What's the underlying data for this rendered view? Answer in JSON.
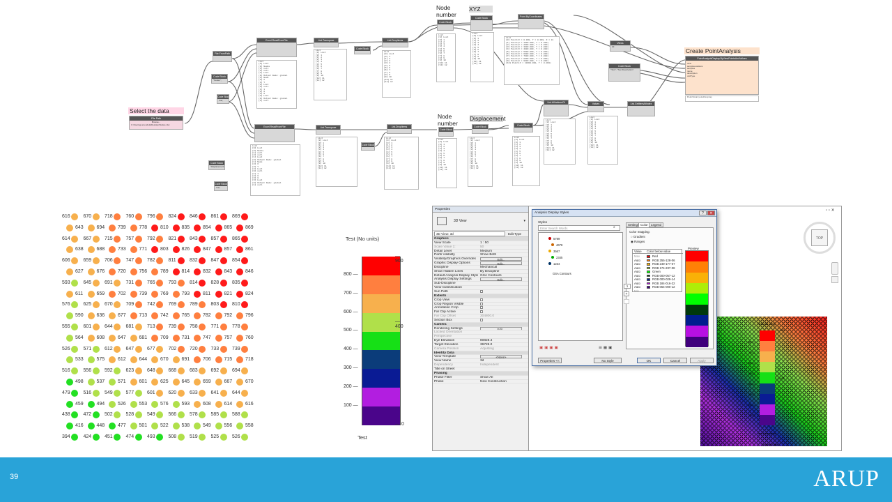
{
  "graph": {
    "labels": {
      "select": "Select the data",
      "node_number_top": "Node number",
      "xyz": "XYZ",
      "node_number_bottom": "Node number",
      "displacement": "Displacement",
      "create": "Create PointAnalysis"
    },
    "nodes": {
      "file_path": "File Path",
      "file_path_btn": "Browse...",
      "file_path_value": "C:\\Users\\g.amendola\\Desktop\\Nodes.xlsx",
      "file_from_path": "File.FromPath",
      "code_block_1": "Code Block",
      "code_block_1_value": "\"Nodes\";",
      "code_block_2": "Code Block",
      "code_block_2_value": "true;",
      "excel_read_1": "Excel.ReadFromFile",
      "list_transpose_1": "List.Transpose",
      "code_block_3": "Code Block",
      "list_drop_1": "List.DropItems",
      "code_block_nodes": "Code Block",
      "code_block_xyz": "Code Block",
      "point_by_coord": "Point.ByCoordinates",
      "code_block_4": "Code Block",
      "code_block_4_value": "\"Displacement\";",
      "code_block_5": "Code Block",
      "code_block_5_value": "true;",
      "excel_read_2": "Excel.ReadFromFile",
      "list_transpose_2": "List.Transpose",
      "code_block_6": "Code Block",
      "list_drop_2": "List.DropItems",
      "code_block_node2": "Code Block",
      "code_block_disp": "Code Block",
      "list_all_indices": "List.AllIndicesOf",
      "views": "Views",
      "views_value": "3d",
      "code_block_7": "Code Block",
      "code_block_7_value": "\"Test\";\n\"Test Description\";",
      "values": "Values",
      "list_get_item": "List.GetItemAtIndex",
      "point_analysis": "PointAnalysisDisplay.ByViewPointsAndValues",
      "point_analysis_out": "PointAnalysisDisplay"
    },
    "watch_lines": [
      "List",
      "[0] List",
      "[0] 1",
      "[1] 2",
      "[2] 3",
      "[3] 4",
      "[4] 5",
      "[5] 6",
      "[6] 7",
      "[7] 8",
      "[8] 9",
      "[9] 10",
      "[10] 11",
      "[11] 12"
    ],
    "point_lines": [
      "List",
      "[0] Point(X = 0.000, Y = 0.000, Z = 0)",
      "[1] Point(X = 1000.000, Y = 0.000)",
      "[2] Point(X = 2000.000, Y = 0.000)",
      "[3] Point(X = 3000.000, Y = 0.000)",
      "[4] Point(X = 4000.000, Y = 0.000)",
      "[5] Point(X = 5000.000, Y = 0.000)",
      "[6] Point(X = 6000.000, Y = 0.000)",
      "[7] Point(X = 7000.000, Y = 0.000)",
      "[8] Point(X = 8000.000, Y = 0.000)",
      "[9] Point(X = 9000.000, Y = 0.000)",
      "[10] Point(X = 10000.000, Y = 0.000)"
    ],
    "excel_lines": [
      "List",
      "[0] List",
      "  [0] Nodes",
      "  [1] null",
      "  [2] null",
      "[1] List",
      "  [0] Output Node: global",
      "  [1] Node",
      "  [2] X",
      "  [3] Y",
      "[2] List",
      "  [0] null",
      "  [1] 1",
      "  [2] 0",
      "  [3] 0",
      "[3] List",
      "  [0] Output Node: global",
      "  [1] null"
    ]
  },
  "dots": {
    "rows": [
      [
        616,
        670,
        718,
        760,
        796,
        824,
        846,
        861,
        869
      ],
      [
        643,
        694,
        739,
        778,
        810,
        835,
        854,
        865,
        869
      ],
      [
        614,
        667,
        715,
        757,
        792,
        821,
        843,
        857,
        865
      ],
      [
        638,
        688,
        733,
        771,
        803,
        826,
        847,
        857,
        861
      ],
      [
        606,
        659,
        706,
        747,
        782,
        811,
        832,
        847,
        854
      ],
      [
        627,
        676,
        720,
        756,
        789,
        814,
        832,
        843,
        846
      ],
      [
        593,
        645,
        691,
        731,
        765,
        793,
        814,
        828,
        835
      ],
      [
        611,
        659,
        702,
        739,
        769,
        793,
        811,
        821,
        824
      ],
      [
        576,
        625,
        670,
        709,
        742,
        769,
        789,
        803,
        810
      ],
      [
        590,
        636,
        677,
        713,
        742,
        765,
        782,
        792,
        796
      ],
      [
        555,
        601,
        644,
        681,
        713,
        739,
        758,
        771,
        778
      ],
      [
        564,
        608,
        647,
        681,
        709,
        731,
        747,
        757,
        760
      ],
      [
        526,
        571,
        612,
        647,
        677,
        702,
        720,
        733,
        739
      ],
      [
        533,
        575,
        612,
        644,
        670,
        691,
        706,
        715,
        718
      ],
      [
        516,
        556,
        592,
        623,
        648,
        668,
        683,
        692,
        694
      ],
      [
        498,
        537,
        571,
        601,
        625,
        645,
        659,
        667,
        670
      ],
      [
        479,
        516,
        549,
        577,
        601,
        620,
        633,
        641,
        644
      ],
      [
        459,
        494,
        526,
        553,
        576,
        593,
        608,
        614,
        616
      ],
      [
        438,
        472,
        502,
        528,
        549,
        566,
        578,
        585,
        588
      ],
      [
        416,
        448,
        477,
        501,
        522,
        538,
        549,
        556,
        558
      ],
      [
        394,
        424,
        451,
        474,
        493,
        508,
        519,
        525,
        526
      ]
    ],
    "legend": {
      "title": "Test (No units)",
      "footer": "Test",
      "ticks_left": [
        "800",
        "700",
        "600",
        "500",
        "400",
        "300",
        "200",
        "100"
      ],
      "ticks_right": [
        "900",
        "400",
        "0"
      ],
      "colors": [
        "#ff0000",
        "#ff7f3f",
        "#f7b04d",
        "#b0e04a",
        "#16e016",
        "#0b3c7a",
        "#0a1b94",
        "#b21ee0",
        "#4a058a"
      ]
    }
  },
  "revit": {
    "properties": {
      "title": "Properties",
      "type_name": "3D View",
      "selector": "3D View: 3d",
      "edit_type": "Edit Type",
      "rows": [
        {
          "k": "Graphics",
          "v": "",
          "t": "sec"
        },
        {
          "k": "View Scale",
          "v": "1 : 50",
          "t": ""
        },
        {
          "k": "Scale Value 1:",
          "v": "50",
          "t": "grey"
        },
        {
          "k": "Detail Level",
          "v": "Medium",
          "t": ""
        },
        {
          "k": "Parts Visibility",
          "v": "Show Both",
          "t": ""
        },
        {
          "k": "Visibility/Graphics Overrides",
          "v": "Edit...",
          "t": "btn"
        },
        {
          "k": "Graphic Display Options",
          "v": "Edit...",
          "t": "btn"
        },
        {
          "k": "Discipline",
          "v": "Mechanical",
          "t": ""
        },
        {
          "k": "Show Hidden Lines",
          "v": "By Discipline",
          "t": ""
        },
        {
          "k": "Default Analysis Display Style",
          "v": "GSA Contours",
          "t": ""
        },
        {
          "k": "Analysis Display Settings",
          "v": "Edit...",
          "t": "btn"
        },
        {
          "k": "Sub-Discipline",
          "v": "",
          "t": ""
        },
        {
          "k": "View Classification",
          "v": "",
          "t": ""
        },
        {
          "k": "Sun Path",
          "v": "",
          "t": "chk"
        },
        {
          "k": "Extents",
          "v": "",
          "t": "sec"
        },
        {
          "k": "Crop View",
          "v": "",
          "t": "chk"
        },
        {
          "k": "Crop Region Visible",
          "v": "",
          "t": "chk"
        },
        {
          "k": "Annotation Crop",
          "v": "",
          "t": "chk"
        },
        {
          "k": "Far Clip Active",
          "v": "",
          "t": "chk"
        },
        {
          "k": "Far Clip Offset",
          "v": "304800.0",
          "t": "grey"
        },
        {
          "k": "Section Box",
          "v": "",
          "t": "chk"
        },
        {
          "k": "Camera",
          "v": "",
          "t": "sec"
        },
        {
          "k": "Rendering Settings",
          "v": "Edit...",
          "t": "btn"
        },
        {
          "k": "Locked Orientation",
          "v": "",
          "t": "grey"
        },
        {
          "k": "Perspective",
          "v": "",
          "t": "grey"
        },
        {
          "k": "Eye Elevation",
          "v": "80828.4",
          "t": ""
        },
        {
          "k": "Target Elevation",
          "v": "36726.0",
          "t": ""
        },
        {
          "k": "Camera Position",
          "v": "Adjusting",
          "t": "grey"
        },
        {
          "k": "Identity Data",
          "v": "",
          "t": "sec"
        },
        {
          "k": "View Template",
          "v": "<None>",
          "t": "btn"
        },
        {
          "k": "View Name",
          "v": "3d",
          "t": ""
        },
        {
          "k": "Dependency",
          "v": "Independent",
          "t": "grey"
        },
        {
          "k": "Title on Sheet",
          "v": "",
          "t": ""
        },
        {
          "k": "Phasing",
          "v": "",
          "t": "sec"
        },
        {
          "k": "Phase Filter",
          "v": "Show All",
          "t": ""
        },
        {
          "k": "Phase",
          "v": "New Construction",
          "t": ""
        }
      ]
    },
    "dialog": {
      "title": "Analysis Display Styles",
      "styles_label": "Styles",
      "search_placeholder": "Enter Search Words",
      "style_item": "GSA Contours",
      "preview_values": [
        "5789",
        "4678",
        "3567",
        "2345",
        "1234"
      ],
      "tabs": [
        "Settings",
        "Color",
        "Legend"
      ],
      "color_mapping": "Color mapping:",
      "gradient": "Gradient",
      "ranges": "Ranges",
      "table_header_value": "Value",
      "table_header_color": "Color below value",
      "preview_label": "Preview",
      "table_rows": [
        {
          "v": "Max",
          "c": "Red",
          "col": "#ff0000"
        },
        {
          "v": "Auto",
          "c": "RGB 255-128-06",
          "col": "#ff8006"
        },
        {
          "v": "Auto",
          "c": "RGB 249-177-07",
          "col": "#f9b107"
        },
        {
          "v": "Auto",
          "c": "RGB 174-237-08",
          "col": "#aeed08"
        },
        {
          "v": "Auto",
          "c": "Green",
          "col": "#00ff00"
        },
        {
          "v": "Auto",
          "c": "RGB 000-057-12",
          "col": "#00390c"
        },
        {
          "v": "Auto",
          "c": "RGB 000-029-14",
          "col": "#001d8e"
        },
        {
          "v": "Auto",
          "c": "RGB 184-016-22",
          "col": "#b810e2"
        },
        {
          "v": "Auto",
          "c": "RGB 064-000-12",
          "col": "#40007c"
        },
        {
          "v": "Min",
          "c": "",
          "col": "#ffffff"
        }
      ],
      "side_value": "1",
      "btn_properties": "Properties <<",
      "btn_no_style": "No Style",
      "btn_ok": "OK",
      "btn_cancel": "Cancel",
      "btn_apply": "Apply"
    },
    "viewcube_label": "TOP",
    "mini_legend": {
      "title": "Test (No units)",
      "ticks": [
        "800",
        "700",
        "600",
        "500",
        "400",
        "300",
        "200",
        "100"
      ],
      "right_ticks": [
        "900",
        "400",
        "0"
      ],
      "footer1": "Test Description",
      "footer2": "Dynamo Data"
    }
  },
  "footer": {
    "page_number": "39",
    "logo": "ARUP"
  }
}
